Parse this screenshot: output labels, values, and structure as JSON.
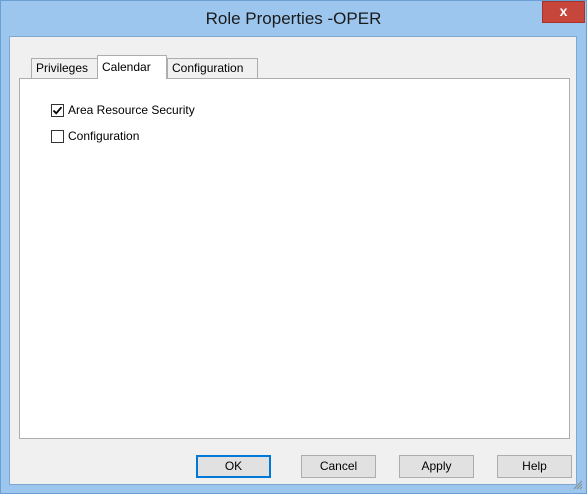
{
  "window": {
    "title": "Role Properties -OPER",
    "close_glyph": "x",
    "close_color": "#c7463c",
    "frame_color": "#9cc6ee"
  },
  "tabs": [
    {
      "label": "Privileges",
      "active": false
    },
    {
      "label": "Calendar",
      "active": true
    },
    {
      "label": "Configuration",
      "active": false
    }
  ],
  "panel": {
    "checkboxes": [
      {
        "label": "Area Resource Security",
        "checked": true
      },
      {
        "label": "Configuration",
        "checked": false
      }
    ]
  },
  "buttons": {
    "ok": "OK",
    "cancel": "Cancel",
    "apply": "Apply",
    "help": "Help"
  }
}
